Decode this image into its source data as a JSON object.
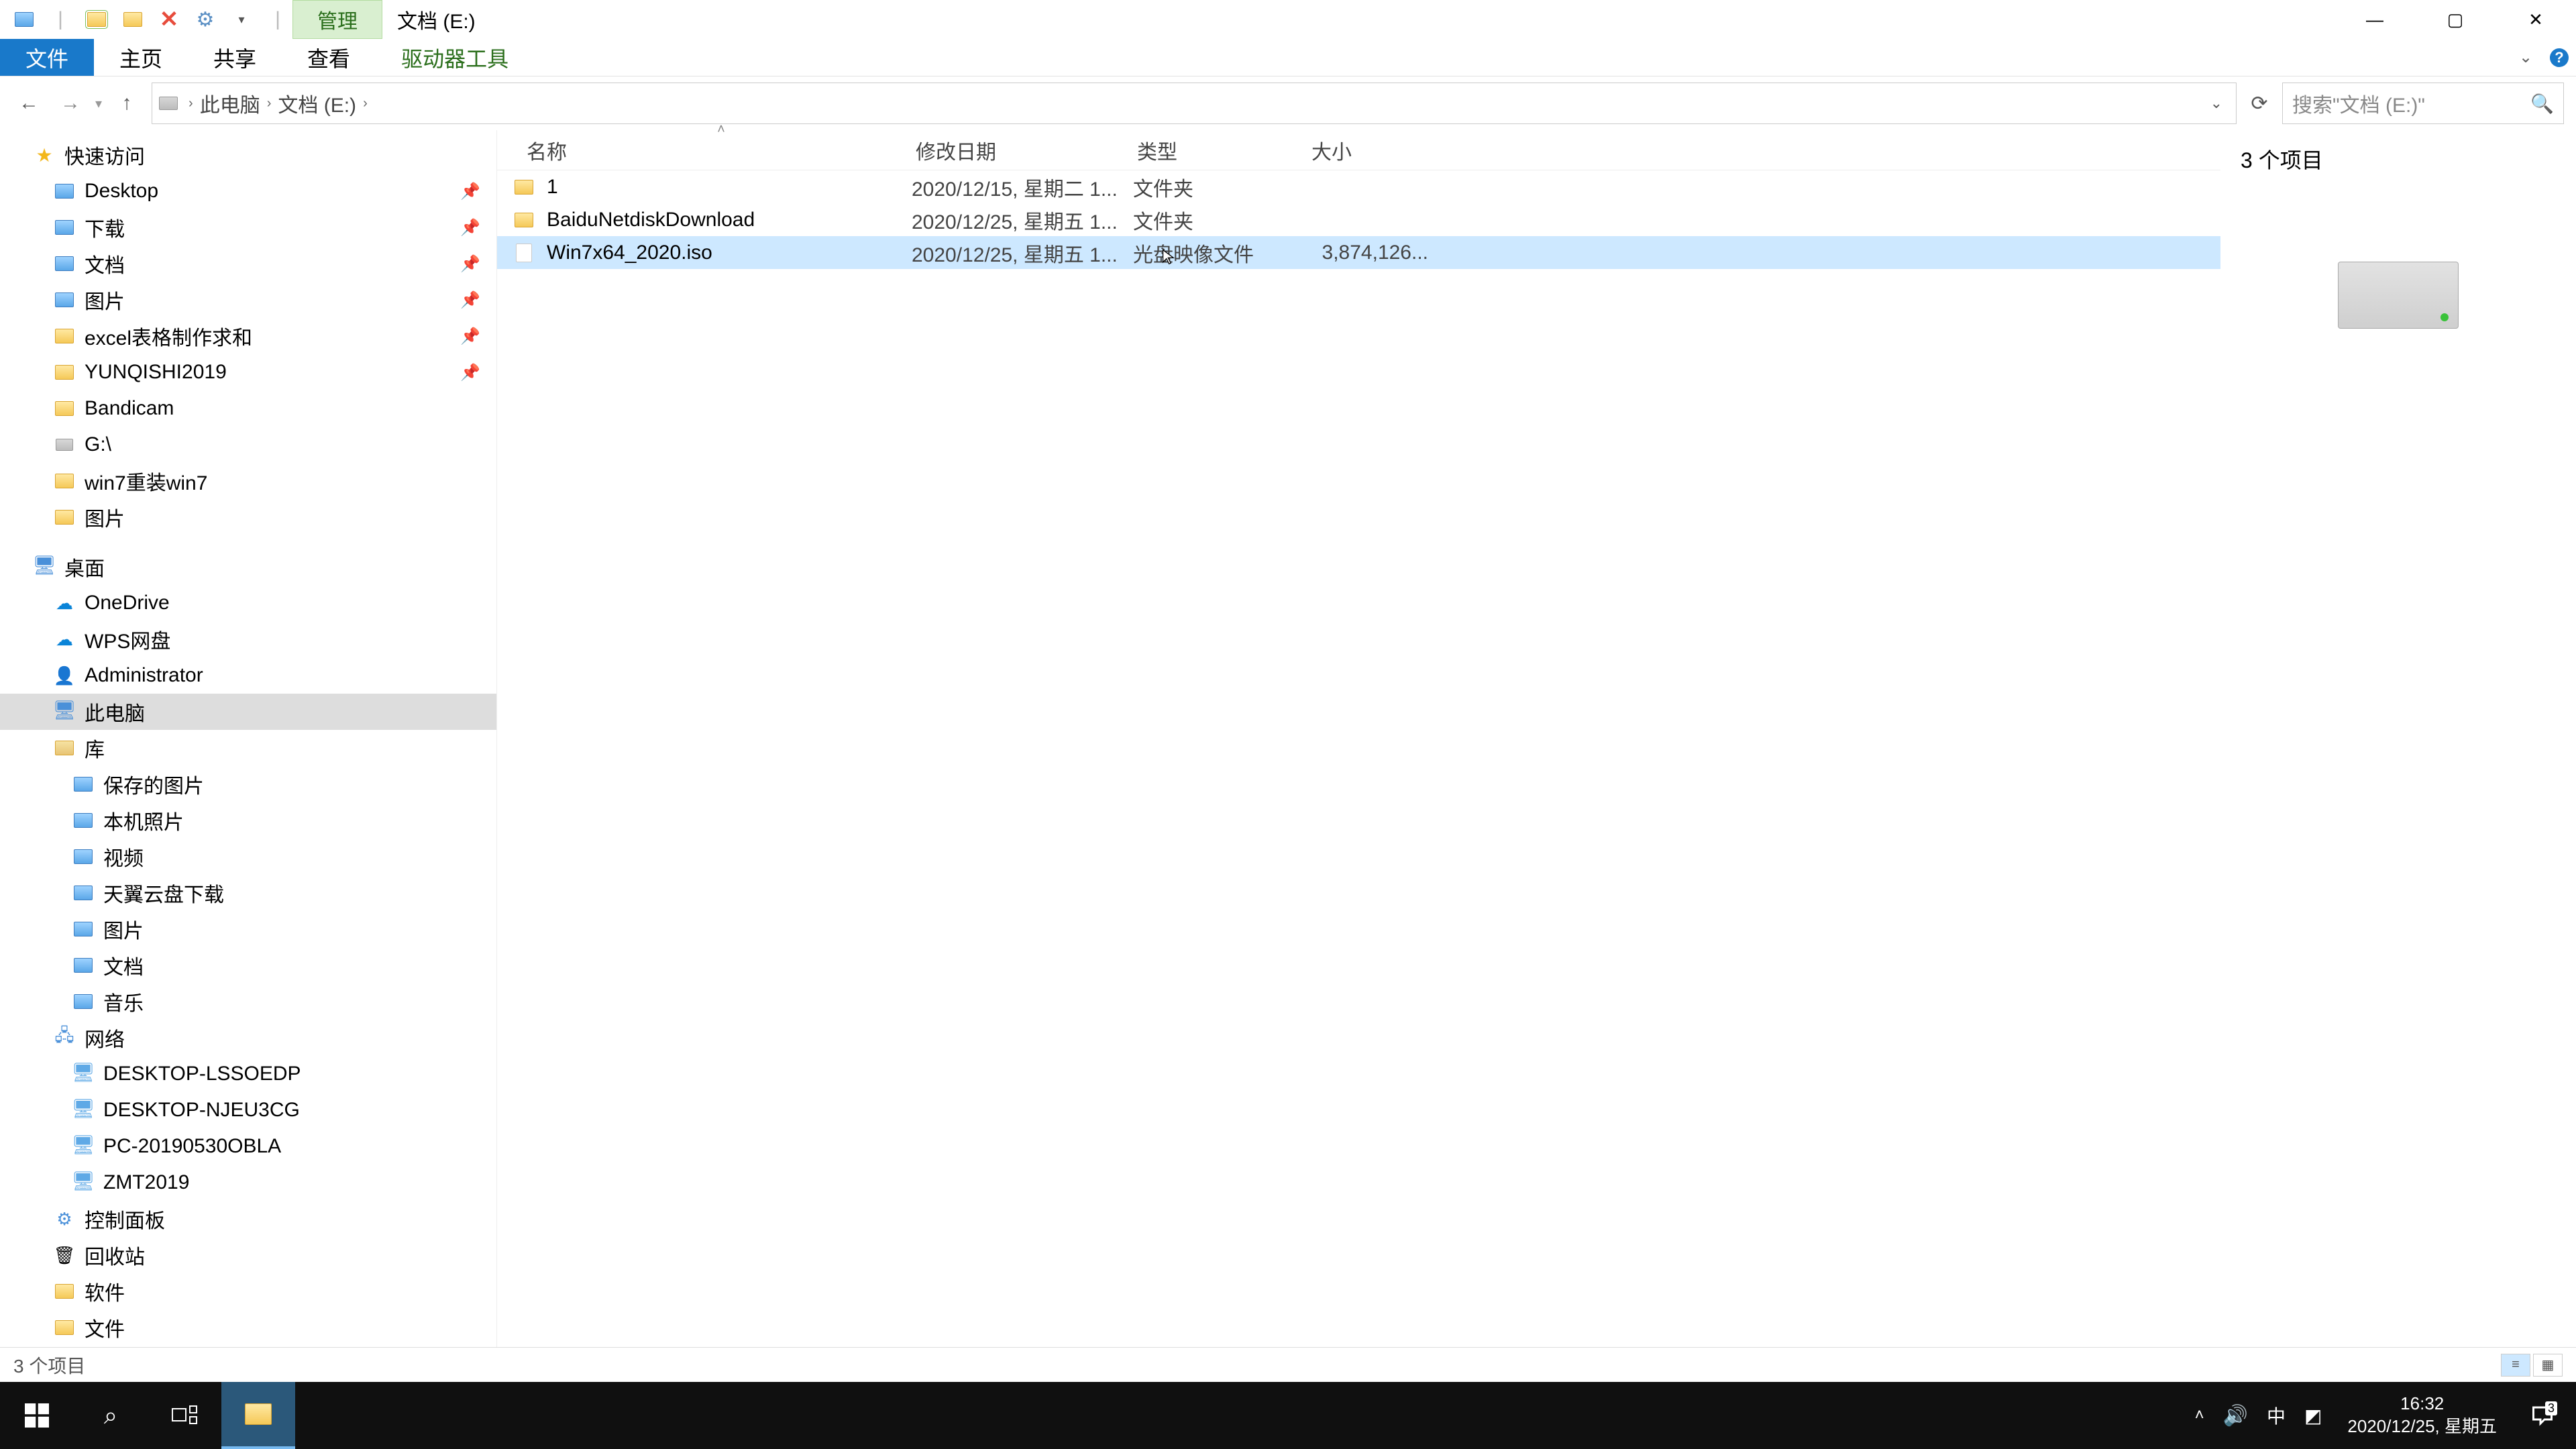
{
  "titlebar": {
    "manage_label": "管理",
    "title": "文档 (E:)"
  },
  "ribbon": {
    "file": "文件",
    "home": "主页",
    "share": "共享",
    "view": "查看",
    "drive_tools": "驱动器工具"
  },
  "address": {
    "crumbs": [
      "此电脑",
      "文档 (E:)"
    ],
    "search_placeholder": "搜索\"文档 (E:)\""
  },
  "columns": {
    "name": "名称",
    "date": "修改日期",
    "type": "类型",
    "size": "大小"
  },
  "files": [
    {
      "icon": "folder",
      "name": "1",
      "date": "2020/12/15, 星期二 1...",
      "type": "文件夹",
      "size": ""
    },
    {
      "icon": "folder",
      "name": "BaiduNetdiskDownload",
      "date": "2020/12/25, 星期五 1...",
      "type": "文件夹",
      "size": ""
    },
    {
      "icon": "iso",
      "name": "Win7x64_2020.iso",
      "date": "2020/12/25, 星期五 1...",
      "type": "光盘映像文件",
      "size": "3,874,126..."
    }
  ],
  "selected_row": 2,
  "preview": {
    "count_text": "3 个项目"
  },
  "status": {
    "text": "3 个项目"
  },
  "sidebar": {
    "groups": [
      {
        "kind": "item",
        "indent": 50,
        "icon": "star",
        "label": "快速访问"
      },
      {
        "kind": "item",
        "indent": 80,
        "icon": "folder-blue",
        "label": "Desktop",
        "pin": true
      },
      {
        "kind": "item",
        "indent": 80,
        "icon": "folder-blue",
        "label": "下载",
        "pin": true
      },
      {
        "kind": "item",
        "indent": 80,
        "icon": "folder-blue",
        "label": "文档",
        "pin": true
      },
      {
        "kind": "item",
        "indent": 80,
        "icon": "folder-blue",
        "label": "图片",
        "pin": true
      },
      {
        "kind": "item",
        "indent": 80,
        "icon": "folder",
        "label": "excel表格制作求和",
        "pin": true
      },
      {
        "kind": "item",
        "indent": 80,
        "icon": "folder",
        "label": "YUNQISHI2019",
        "pin": true
      },
      {
        "kind": "item",
        "indent": 80,
        "icon": "folder",
        "label": "Bandicam"
      },
      {
        "kind": "item",
        "indent": 80,
        "icon": "drive",
        "label": "G:\\"
      },
      {
        "kind": "item",
        "indent": 80,
        "icon": "folder",
        "label": "win7重装win7"
      },
      {
        "kind": "item",
        "indent": 80,
        "icon": "folder",
        "label": "图片"
      },
      {
        "kind": "spacer"
      },
      {
        "kind": "item",
        "indent": 50,
        "icon": "desktop",
        "label": "桌面"
      },
      {
        "kind": "item",
        "indent": 80,
        "icon": "onedrive",
        "label": "OneDrive"
      },
      {
        "kind": "item",
        "indent": 80,
        "icon": "wps",
        "label": "WPS网盘"
      },
      {
        "kind": "item",
        "indent": 80,
        "icon": "user",
        "label": "Administrator"
      },
      {
        "kind": "item",
        "indent": 80,
        "icon": "pc",
        "label": "此电脑",
        "selected": true
      },
      {
        "kind": "item",
        "indent": 80,
        "icon": "lib",
        "label": "库"
      },
      {
        "kind": "item",
        "indent": 108,
        "icon": "folder-blue",
        "label": "保存的图片"
      },
      {
        "kind": "item",
        "indent": 108,
        "icon": "folder-blue",
        "label": "本机照片"
      },
      {
        "kind": "item",
        "indent": 108,
        "icon": "folder-blue",
        "label": "视频"
      },
      {
        "kind": "item",
        "indent": 108,
        "icon": "folder-blue",
        "label": "天翼云盘下载"
      },
      {
        "kind": "item",
        "indent": 108,
        "icon": "folder-blue",
        "label": "图片"
      },
      {
        "kind": "item",
        "indent": 108,
        "icon": "folder-blue",
        "label": "文档"
      },
      {
        "kind": "item",
        "indent": 108,
        "icon": "folder-blue",
        "label": "音乐"
      },
      {
        "kind": "item",
        "indent": 80,
        "icon": "network",
        "label": "网络"
      },
      {
        "kind": "item",
        "indent": 108,
        "icon": "netpc",
        "label": "DESKTOP-LSSOEDP"
      },
      {
        "kind": "item",
        "indent": 108,
        "icon": "netpc",
        "label": "DESKTOP-NJEU3CG"
      },
      {
        "kind": "item",
        "indent": 108,
        "icon": "netpc",
        "label": "PC-20190530OBLA"
      },
      {
        "kind": "item",
        "indent": 108,
        "icon": "netpc",
        "label": "ZMT2019"
      },
      {
        "kind": "item",
        "indent": 80,
        "icon": "cpl",
        "label": "控制面板"
      },
      {
        "kind": "item",
        "indent": 80,
        "icon": "recycle",
        "label": "回收站"
      },
      {
        "kind": "item",
        "indent": 80,
        "icon": "folder",
        "label": "软件"
      },
      {
        "kind": "item",
        "indent": 80,
        "icon": "folder",
        "label": "文件"
      }
    ]
  },
  "taskbar": {
    "time": "16:32",
    "date": "2020/12/25, 星期五",
    "ime": "中",
    "notif_count": "3"
  }
}
